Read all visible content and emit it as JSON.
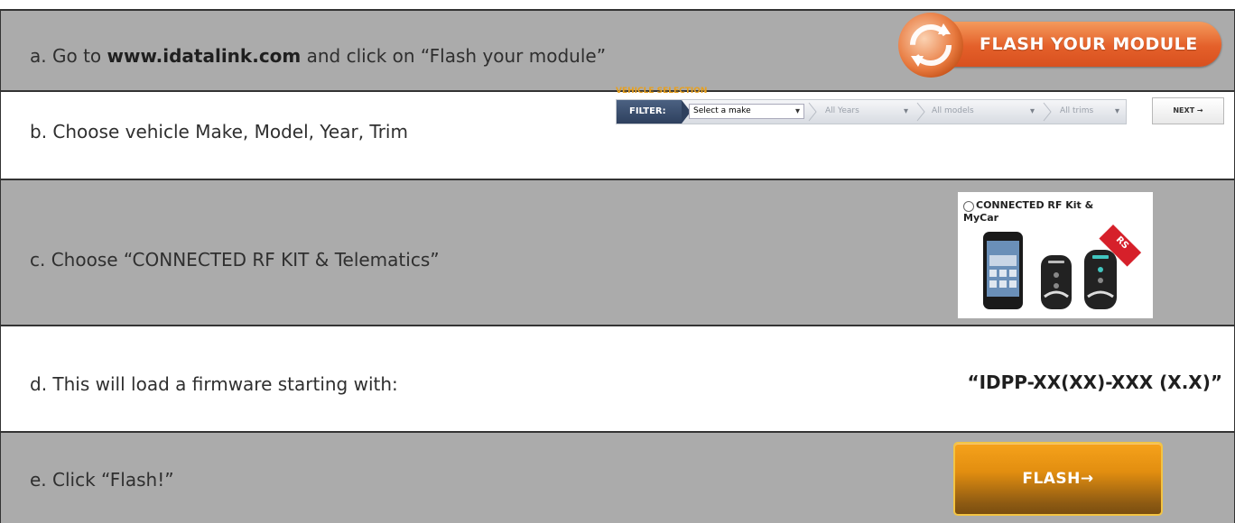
{
  "steps": {
    "a": {
      "prefix": "a.  Go to ",
      "link": "www.idatalink.com",
      "suffix": " and click on “Flash your module”"
    },
    "b": {
      "text": "b.  Choose vehicle Make, Model, Year, Trim"
    },
    "c": {
      "text": "c.  Choose “CONNECTED RF KIT & Telematics”"
    },
    "d": {
      "text": "d.  This will load a firmware starting with:"
    },
    "e": {
      "text": "e.  Click “Flash!”"
    }
  },
  "flash_module_button": {
    "label": "FLASH YOUR MODULE"
  },
  "vehicle_selection": {
    "title": "VEHICLE SELECTION",
    "filter_label": "FILTER:",
    "make": "Select a make",
    "years": "All Years",
    "models": "All models",
    "trims": "All trims",
    "next_label": "NEXT →"
  },
  "kit": {
    "line1": "CONNECTED RF Kit &",
    "line2": "MyCar",
    "badge": "RS"
  },
  "firmware": {
    "value": "“IDPP-XX(XX)-XXX (X.X)”"
  },
  "flash_button": {
    "label": "FLASH→"
  },
  "colors": {
    "grey_row": "#ababab",
    "accent_orange": "#e4602a",
    "flash_orange": "#f6a21b"
  }
}
